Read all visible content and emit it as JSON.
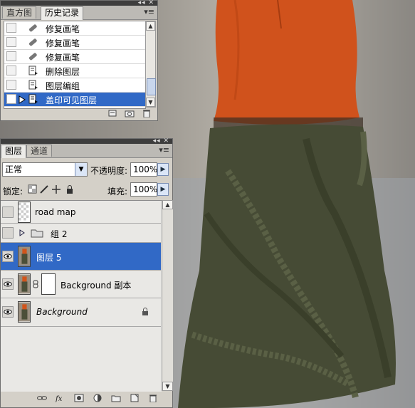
{
  "history_panel": {
    "tabs": [
      "直方图",
      "历史记录"
    ],
    "active_tab": "历史记录",
    "items": [
      {
        "label": "修复画笔",
        "icon": "bandage-icon"
      },
      {
        "label": "修复画笔",
        "icon": "bandage-icon"
      },
      {
        "label": "修复画笔",
        "icon": "bandage-icon"
      },
      {
        "label": "删除图层",
        "icon": "history-state-icon"
      },
      {
        "label": "图层编组",
        "icon": "history-state-icon"
      },
      {
        "label": "盖印可见图层",
        "icon": "history-state-icon",
        "selected": true
      }
    ],
    "footer_icons": [
      "new-document-from-state-icon",
      "snapshot-camera-icon",
      "trash-icon"
    ]
  },
  "layers_panel": {
    "tabs": [
      "图层",
      "通道"
    ],
    "active_tab": "图层",
    "blend_mode": "正常",
    "opacity_label": "不透明度:",
    "opacity_value": "100%",
    "lock_label": "锁定:",
    "fill_label": "填充:",
    "fill_value": "100%",
    "layers": [
      {
        "name": "road map",
        "visible": false,
        "type": "transparent"
      },
      {
        "name": "组 2",
        "visible": false,
        "type": "group"
      },
      {
        "name": "图层 5",
        "visible": true,
        "type": "photo",
        "selected": true
      },
      {
        "name": "Background 副本",
        "visible": true,
        "type": "photo-mask"
      },
      {
        "name": "Background",
        "visible": true,
        "type": "photo",
        "locked": true,
        "italic": true
      }
    ],
    "footer_icons": [
      "link-icon",
      "fx-icon",
      "add-mask-icon",
      "adjustment-layer-icon",
      "new-group-icon",
      "new-layer-icon",
      "trash-icon"
    ]
  },
  "colors": {
    "selection": "#3169c6",
    "panel_bg": "#d4d0c8",
    "shirt": "#d2541b",
    "skirt": "#454a34"
  }
}
